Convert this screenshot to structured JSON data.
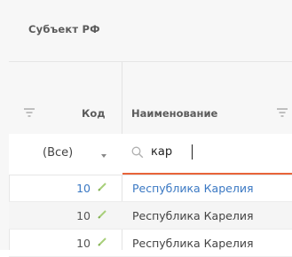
{
  "table": {
    "group_header": "Субъект РФ",
    "columns": [
      {
        "label": "Код"
      },
      {
        "label": "Наименование"
      }
    ],
    "filter": {
      "code_select_value": "(Все)",
      "name_search_value": "кар"
    },
    "rows": [
      {
        "code": "10",
        "name": "Республика Карелия"
      },
      {
        "code": "10",
        "name": "Республика Карелия"
      },
      {
        "code": "10",
        "name": "Республика Карелия"
      }
    ]
  },
  "colors": {
    "link": "#3a78c3",
    "focus_underline": "#e8643a",
    "edit_icon": "#a8cf7a"
  }
}
